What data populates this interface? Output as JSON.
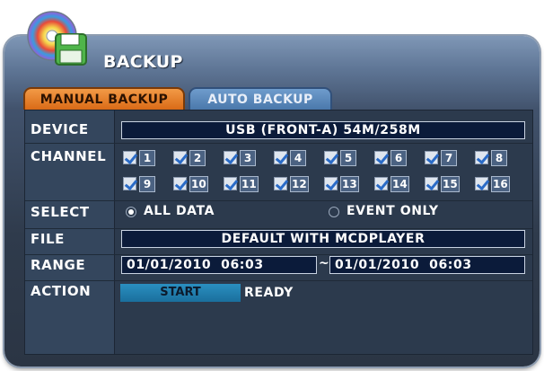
{
  "window": {
    "title": "BACKUP"
  },
  "tabs": [
    {
      "label": "MANUAL BACKUP",
      "active": true
    },
    {
      "label": "AUTO BACKUP",
      "active": false
    }
  ],
  "rows": {
    "device": {
      "label": "DEVICE",
      "value": "USB (FRONT-A) 54M/258M"
    },
    "channel": {
      "label": "CHANNEL",
      "channels": [
        "1",
        "2",
        "3",
        "4",
        "5",
        "6",
        "7",
        "8",
        "9",
        "10",
        "11",
        "12",
        "13",
        "14",
        "15",
        "16"
      ]
    },
    "select": {
      "label": "SELECT",
      "options": [
        "ALL DATA",
        "EVENT ONLY"
      ],
      "selected": "ALL DATA"
    },
    "file": {
      "label": "FILE",
      "value": "DEFAULT WITH MCDPLAYER"
    },
    "range": {
      "label": "RANGE",
      "from": "01/01/2010  06:03",
      "separator": "~",
      "to": "01/01/2010  06:03"
    },
    "action": {
      "label": "ACTION",
      "button": "START",
      "status": "READY"
    }
  },
  "colors": {
    "active_tab": "#e07a25",
    "inactive_tab": "#5a88bb",
    "field_bg": "#0b1b3a",
    "start_button": "#2585b6"
  }
}
